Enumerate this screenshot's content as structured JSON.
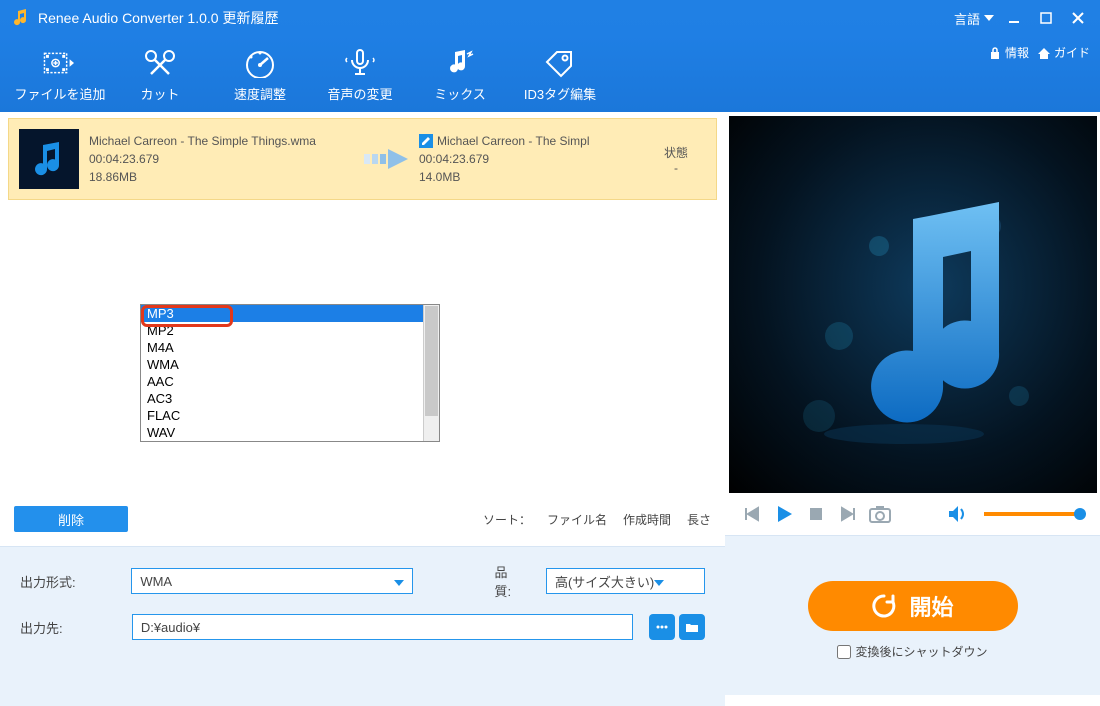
{
  "titlebar": {
    "title": "Renee Audio Converter 1.0.0 更新履歴",
    "language": "言語"
  },
  "toolbar": {
    "items": [
      {
        "label": "ファイルを追加"
      },
      {
        "label": "カット"
      },
      {
        "label": "速度調整"
      },
      {
        "label": "音声の変更"
      },
      {
        "label": "ミックス"
      },
      {
        "label": "ID3タグ編集"
      }
    ],
    "info": "情報",
    "guide": "ガイド"
  },
  "file": {
    "src_name": "Michael Carreon - The Simple Things.wma",
    "src_duration": "00:04:23.679",
    "src_size": "18.86MB",
    "out_name": "Michael Carreon - The Simpl",
    "out_duration": "00:04:23.679",
    "out_size": "14.0MB",
    "status_label": "状態",
    "status_value": "-"
  },
  "dropdown": {
    "options": [
      "MP3",
      "MP2",
      "M4A",
      "WMA",
      "AAC",
      "AC3",
      "FLAC",
      "WAV"
    ]
  },
  "actions": {
    "delete": "削除",
    "sort_label": "ソート：",
    "sort_filename": "ファイル名",
    "sort_created": "作成時間",
    "sort_length": "長さ"
  },
  "bottom": {
    "format_label": "出力形式:",
    "format_value": "WMA",
    "quality_label": "品質:",
    "quality_value": "高(サイズ大きい)",
    "dest_label": "出力先:",
    "dest_value": "D:¥audio¥"
  },
  "right": {
    "start": "開始",
    "shutdown": "変換後にシャットダウン"
  }
}
